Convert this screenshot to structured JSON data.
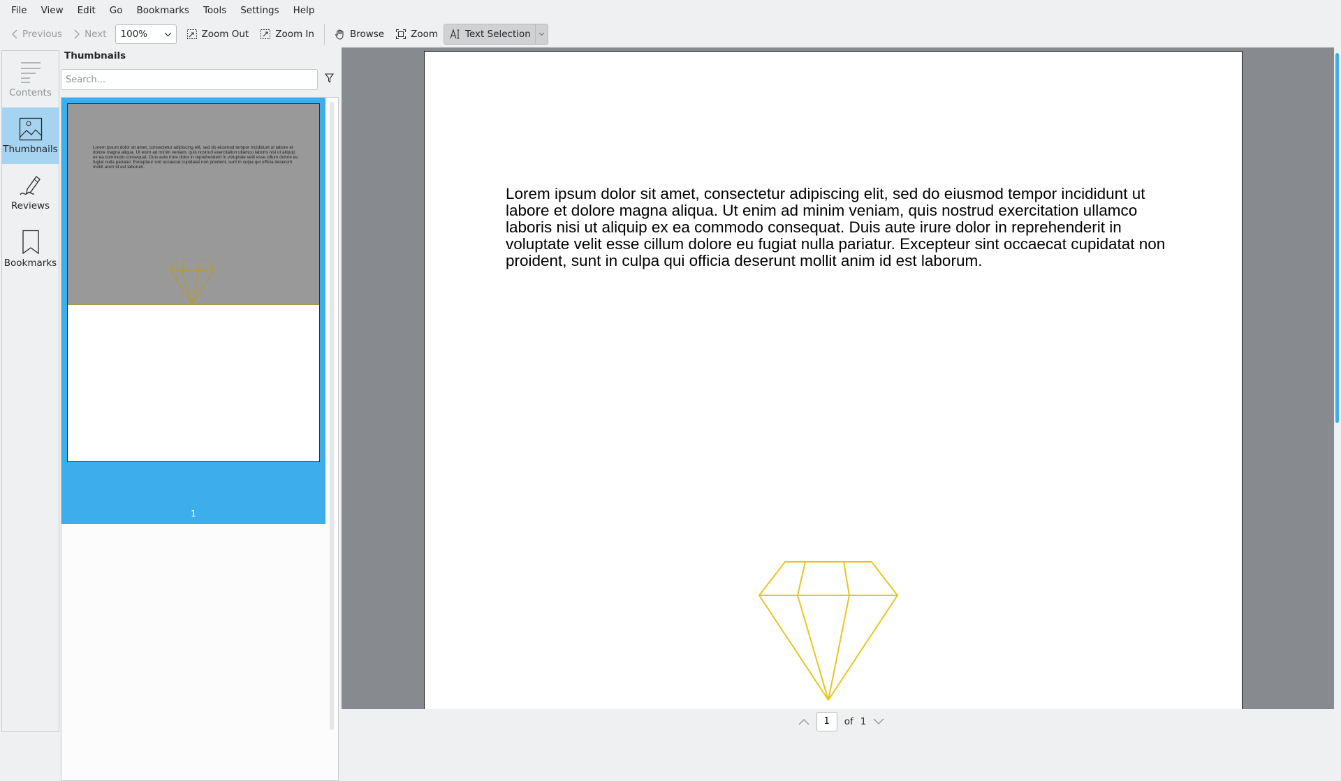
{
  "menu": [
    "File",
    "View",
    "Edit",
    "Go",
    "Bookmarks",
    "Tools",
    "Settings",
    "Help"
  ],
  "toolbar": {
    "previous": "Previous",
    "next": "Next",
    "zoom_value": "100%",
    "zoom_out": "Zoom Out",
    "zoom_in": "Zoom In",
    "browse": "Browse",
    "zoom": "Zoom",
    "text_selection": "Text Selection"
  },
  "sidebar": {
    "items": [
      {
        "label": "Contents",
        "icon": "contents-icon"
      },
      {
        "label": "Thumbnails",
        "icon": "thumbnails-icon",
        "selected": true
      },
      {
        "label": "Reviews",
        "icon": "reviews-icon"
      },
      {
        "label": "Bookmarks",
        "icon": "bookmark-icon"
      }
    ]
  },
  "thumbnails": {
    "title": "Thumbnails",
    "search_placeholder": "Search...",
    "page_number": "1"
  },
  "document": {
    "text": "Lorem ipsum dolor sit amet, consectetur adipiscing elit, sed do eiusmod tempor incididunt ut labore et dolore magna aliqua. Ut enim ad minim veniam, quis nostrud exercitation ullamco laboris nisi ut aliquip ex ea commodo consequat. Duis aute irure dolor in reprehenderit in voluptate velit esse cillum dolore eu fugiat nulla pariatur. Excepteur sint occaecat cupidatat non proident, sunt in culpa qui officia deserunt mollit anim id est laborum."
  },
  "pagination": {
    "current": "1",
    "of_label": "of",
    "total": "1"
  },
  "colors": {
    "accent": "#3daee9",
    "viewer_bg": "#878b90",
    "gem": "#e8c520"
  }
}
